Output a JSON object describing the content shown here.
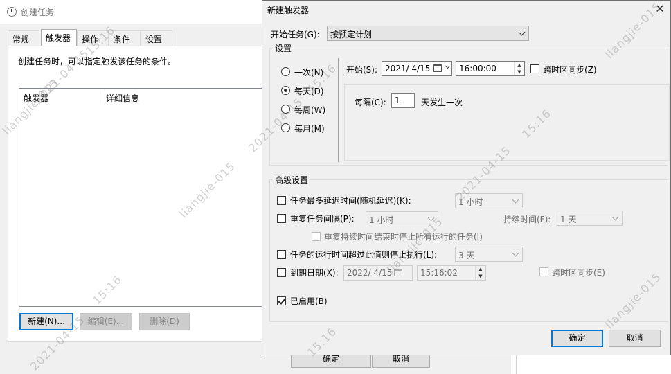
{
  "background_window": {
    "title": "创建任务",
    "tabs": [
      "常规",
      "触发器",
      "操作",
      "条件",
      "设置"
    ],
    "active_tab": "触发器",
    "description": "创建任务时，可以指定触发该任务的条件。",
    "list_columns": [
      "触发器",
      "详细信息"
    ],
    "buttons": {
      "new": "新建(N)...",
      "edit": "编辑(E)...",
      "delete": "删除(D)"
    },
    "footer_buttons": {
      "ok": "确定",
      "cancel": "取消"
    }
  },
  "dialog": {
    "title": "新建触发器",
    "close_glyph": "✕",
    "begin_task_label": "开始任务(G):",
    "begin_task_value": "按预定计划",
    "settings": {
      "group_label": "设置",
      "schedule_options": [
        {
          "label": "一次(N)",
          "selected": false
        },
        {
          "label": "每天(D)",
          "selected": true
        },
        {
          "label": "每周(W)",
          "selected": false
        },
        {
          "label": "每月(M)",
          "selected": false
        }
      ],
      "start_label": "开始(S):",
      "start_date": "2021/  4/15",
      "start_time": "16:00:00",
      "sync_timezone_label": "跨时区同步(Z)",
      "recur_label": "每隔(C):",
      "recur_value": "1",
      "recur_suffix": "天发生一次"
    },
    "advanced": {
      "group_label": "高级设置",
      "delay_label": "任务最多延迟时间(随机延迟)(K):",
      "delay_value": "1 小时",
      "repeat_label": "重复任务间隔(P):",
      "repeat_value": "1 小时",
      "duration_label": "持续时间(F):",
      "duration_value": "1 天",
      "stop_all_label": "重复持续时间结束时停止所有运行的任务(I)",
      "stop_if_longer_label": "任务的运行时间超过此值则停止执行(L):",
      "stop_if_longer_value": "3 天",
      "expire_label": "到期日期(X):",
      "expire_date": "2022/  4/15",
      "expire_time": "15:16:02",
      "expire_sync_label": "跨时区同步(E)",
      "enabled_label": "已启用(B)",
      "enabled_checked": true
    },
    "ok_label": "确定",
    "cancel_label": "取消"
  },
  "watermark": [
    "liangjie-015",
    "2021-04-15",
    "15:16"
  ],
  "colors": {
    "accent": "#0078d7",
    "dialog_bg": "#f0f0f0"
  }
}
